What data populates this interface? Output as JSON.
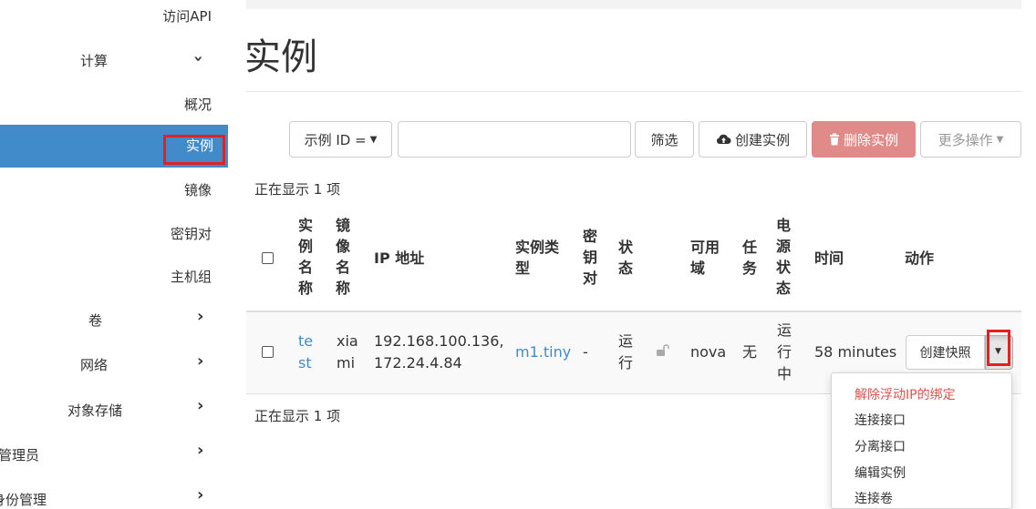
{
  "sidebar": {
    "items": [
      {
        "label": "访问API"
      },
      {
        "label": "计算"
      },
      {
        "label": "概况"
      },
      {
        "label": "实例"
      },
      {
        "label": "镜像"
      },
      {
        "label": "密钥对"
      },
      {
        "label": "主机组"
      },
      {
        "label": "卷"
      },
      {
        "label": "网络"
      },
      {
        "label": "对象存储"
      },
      {
        "label": "管理员"
      },
      {
        "label": "身份管理"
      }
    ]
  },
  "page": {
    "title": "实例"
  },
  "toolbar": {
    "filter_select": "示例 ID =",
    "search_value": "",
    "filter_button": "筛选",
    "create_button": "创建实例",
    "delete_button": "删除实例",
    "more_button": "更多操作"
  },
  "showing_text": "正在显示 1 项",
  "table": {
    "headers": {
      "name": [
        "实",
        "例",
        "名",
        "称"
      ],
      "image": [
        "镜",
        "像",
        "名",
        "称"
      ],
      "ip": "IP 地址",
      "flavor": [
        "实例类",
        "型"
      ],
      "keypair": [
        "密",
        "钥",
        "对"
      ],
      "status": [
        "状",
        "态"
      ],
      "az": [
        "可用",
        "域"
      ],
      "task": [
        "任",
        "务"
      ],
      "power": [
        "电",
        "源",
        "状",
        "态"
      ],
      "time": "时间",
      "actions": "动作"
    },
    "rows": [
      {
        "name": [
          "te",
          "st"
        ],
        "image": [
          "xia",
          "mi"
        ],
        "ip": [
          "192.168.100.136,",
          "172.24.4.84"
        ],
        "flavor": "m1.tiny",
        "keypair": "-",
        "status": [
          "运",
          "行"
        ],
        "az": "nova",
        "task": "无",
        "power": [
          "运",
          "行",
          "中"
        ],
        "time": "58 minutes",
        "action_button": "创建快照"
      }
    ]
  },
  "dropdown": {
    "items": [
      "解除浮动IP的绑定",
      "连接接口",
      "分离接口",
      "编辑实例",
      "连接卷"
    ]
  },
  "colors": {
    "primary": "#428bca",
    "danger": "#e08b89",
    "highlight": "#e52020"
  }
}
